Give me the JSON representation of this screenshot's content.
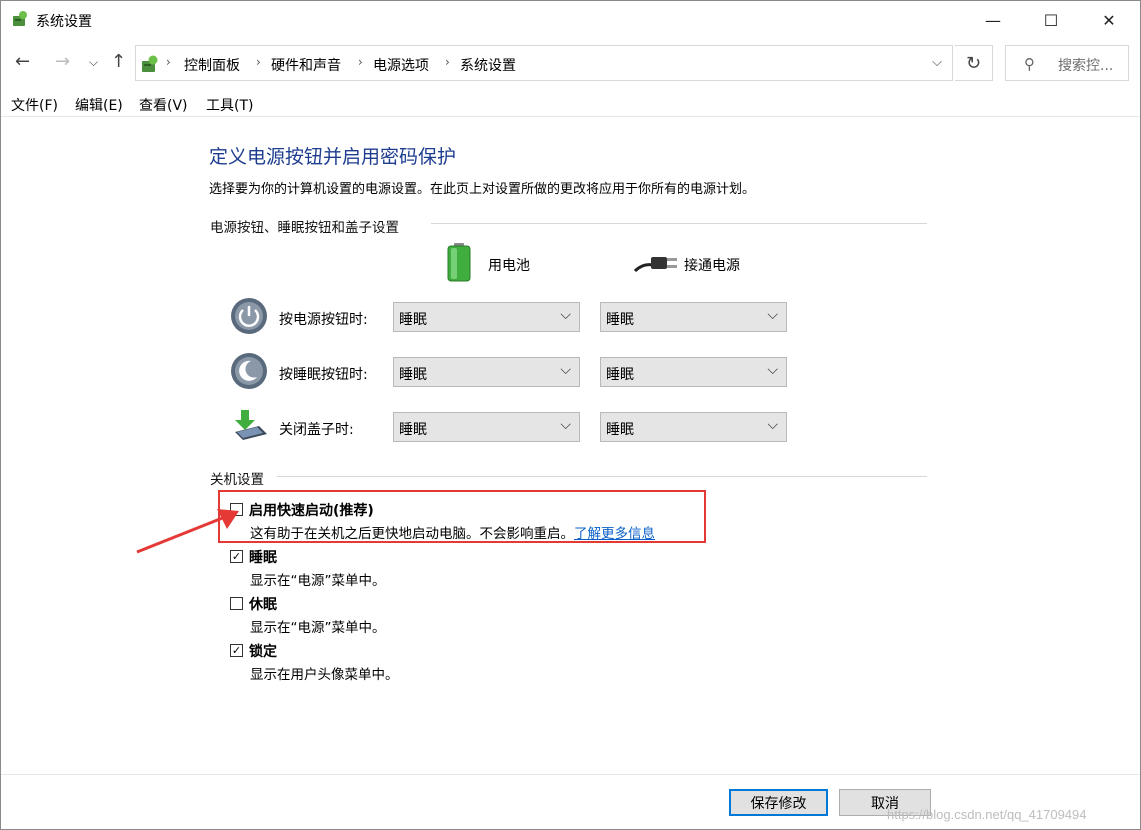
{
  "window": {
    "title": "系统设置"
  },
  "address": {
    "breadcrumbs": [
      "控制面板",
      "硬件和声音",
      "电源选项",
      "系统设置"
    ],
    "search_placeholder": "搜索控..."
  },
  "menu": [
    "文件(F)",
    "编辑(E)",
    "查看(V)",
    "工具(T)"
  ],
  "page": {
    "heading": "定义电源按钮并启用密码保护",
    "description": "选择要为你的计算机设置的电源设置。在此页上对设置所做的更改将应用于你所有的电源计划。",
    "group_buttons": "电源按钮、睡眠按钮和盖子设置",
    "col_battery": "用电池",
    "col_plugged": "接通电源",
    "rows": [
      {
        "label": "按电源按钮时:",
        "battery": "睡眠",
        "plugged": "睡眠"
      },
      {
        "label": "按睡眠按钮时:",
        "battery": "睡眠",
        "plugged": "睡眠"
      },
      {
        "label": "关闭盖子时:",
        "battery": "睡眠",
        "plugged": "睡眠"
      }
    ],
    "group_shutdown": "关机设置",
    "shutdown_options": [
      {
        "label": "启用快速启动(推荐)",
        "checked": false,
        "desc": "这有助于在关机之后更快地启动电脑。不会影响重启。",
        "link": "了解更多信息"
      },
      {
        "label": "睡眠",
        "checked": true,
        "desc": "显示在“电源”菜单中。"
      },
      {
        "label": "休眠",
        "checked": false,
        "desc": "显示在“电源”菜单中。"
      },
      {
        "label": "锁定",
        "checked": true,
        "desc": "显示在用户头像菜单中。"
      }
    ]
  },
  "buttons": {
    "save": "保存修改",
    "cancel": "取消"
  },
  "watermark": "https://blog.csdn.net/qq_41709494",
  "colors": {
    "heading": "#1e3d8f",
    "link": "#0b61c8",
    "highlight": "#e53935",
    "primary_border": "#0078d7"
  },
  "icons": {
    "app": "control-panel-icon",
    "back": "back-arrow-icon",
    "forward": "forward-arrow-icon",
    "up": "up-arrow-icon",
    "refresh": "refresh-icon",
    "search": "search-icon"
  }
}
